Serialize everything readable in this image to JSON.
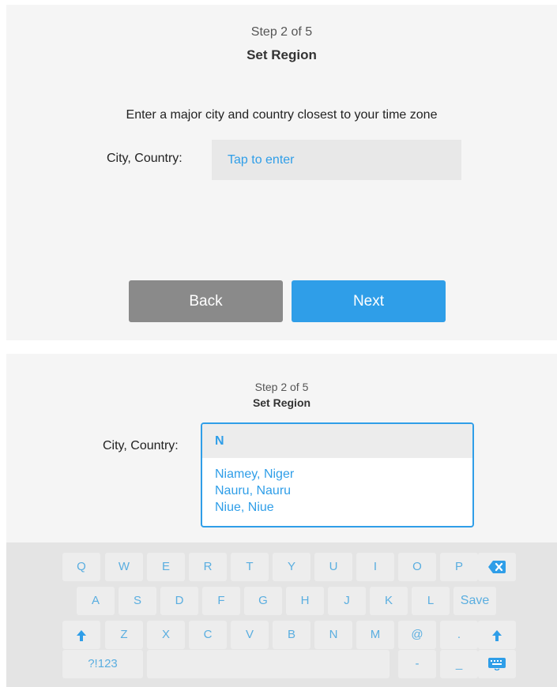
{
  "screen_top": {
    "step_label": "Step 2 of 5",
    "step_title": "Set Region",
    "instruction": "Enter a major city and country closest to your time zone",
    "field_label": "City, Country:",
    "field_placeholder": "Tap to enter",
    "back_label": "Back",
    "next_label": "Next"
  },
  "screen_bottom": {
    "step_label": "Step 2 of 5",
    "step_title": "Set Region",
    "field_label": "City, Country:",
    "field_value": "N",
    "suggestions": [
      "Niamey, Niger",
      "Nauru, Nauru",
      "Niue, Niue"
    ]
  },
  "keyboard": {
    "row1": [
      "Q",
      "W",
      "E",
      "R",
      "T",
      "Y",
      "U",
      "I",
      "O",
      "P"
    ],
    "row2": [
      "A",
      "S",
      "D",
      "F",
      "G",
      "H",
      "J",
      "K",
      "L"
    ],
    "save_label": "Save",
    "row3": [
      "Z",
      "X",
      "C",
      "V",
      "B",
      "N",
      "M",
      "@",
      "."
    ],
    "symbols_label": "?!123",
    "dash": "-",
    "underscore": "_",
    "icons": {
      "backspace": "backspace-icon",
      "shift": "shift-icon",
      "hide_keyboard": "keyboard-icon"
    }
  },
  "colors": {
    "accent": "#2f9ee8",
    "back_button": "#8a8a8a",
    "panel_bg": "#f5f5f5",
    "keyboard_bg": "#e4e4e4"
  }
}
